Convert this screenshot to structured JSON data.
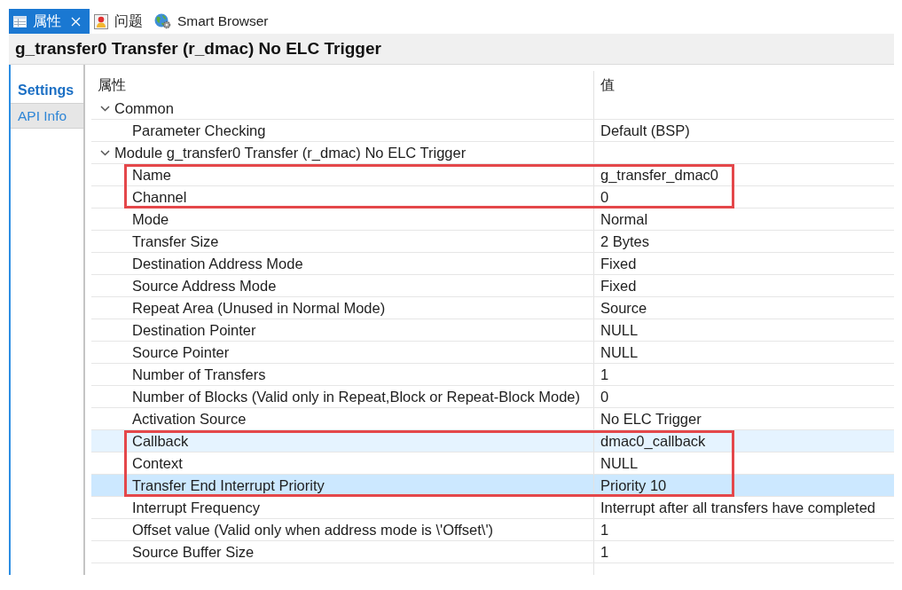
{
  "tabs": [
    {
      "label": "属性",
      "selected": true,
      "closable": true
    },
    {
      "label": "问题",
      "selected": false,
      "closable": false
    },
    {
      "label": "Smart Browser",
      "selected": false,
      "closable": false
    }
  ],
  "title": "g_transfer0 Transfer (r_dmac) No ELC Trigger",
  "side_tabs": [
    {
      "label": "Settings",
      "selected": true
    },
    {
      "label": "API Info",
      "selected": false
    }
  ],
  "properties": {
    "columns": [
      "属性",
      "值"
    ],
    "rows": [
      {
        "label": "Common",
        "expanded": true,
        "selected": false,
        "hovered": false,
        "children": [
          {
            "label": "Parameter Checking",
            "value": "Default (BSP)",
            "selected": false,
            "hovered": false,
            "marked": false
          }
        ]
      },
      {
        "label": "Module g_transfer0 Transfer (r_dmac) No ELC Trigger",
        "expanded": true,
        "selected": false,
        "hovered": false,
        "children": [
          {
            "label": "Name",
            "value": "g_transfer_dmac0",
            "selected": false,
            "hovered": false,
            "marked": true
          },
          {
            "label": "Channel",
            "value": "0",
            "selected": false,
            "hovered": false,
            "marked": true
          },
          {
            "label": "Mode",
            "value": "Normal",
            "selected": false,
            "hovered": false,
            "marked": false
          },
          {
            "label": "Transfer Size",
            "value": "2 Bytes",
            "selected": false,
            "hovered": false,
            "marked": false
          },
          {
            "label": "Destination Address Mode",
            "value": "Fixed",
            "selected": false,
            "hovered": false,
            "marked": false
          },
          {
            "label": "Source Address Mode",
            "value": "Fixed",
            "selected": false,
            "hovered": false,
            "marked": false
          },
          {
            "label": "Repeat Area (Unused in Normal Mode)",
            "value": "Source",
            "selected": false,
            "hovered": false,
            "marked": false
          },
          {
            "label": "Destination Pointer",
            "value": "NULL",
            "selected": false,
            "hovered": false,
            "marked": false
          },
          {
            "label": "Source Pointer",
            "value": "NULL",
            "selected": false,
            "hovered": false,
            "marked": false
          },
          {
            "label": "Number of Transfers",
            "value": "1",
            "selected": false,
            "hovered": false,
            "marked": false
          },
          {
            "label": "Number of Blocks (Valid only in Repeat,Block or Repeat-Block Mode)",
            "value": "0",
            "selected": false,
            "hovered": false,
            "marked": false
          },
          {
            "label": "Activation Source",
            "value": "No ELC Trigger",
            "selected": false,
            "hovered": false,
            "marked": false
          },
          {
            "label": "Callback",
            "value": "dmac0_callback",
            "selected": false,
            "hovered": true,
            "marked": true
          },
          {
            "label": "Context",
            "value": "NULL",
            "selected": false,
            "hovered": false,
            "marked": true
          },
          {
            "label": "Transfer End Interrupt Priority",
            "value": "Priority 10",
            "selected": true,
            "hovered": false,
            "marked": true
          },
          {
            "label": "Interrupt Frequency",
            "value": "Interrupt after all transfers have completed",
            "selected": false,
            "hovered": false,
            "marked": false
          },
          {
            "label": "Offset value (Valid only when address mode is \\'Offset\\')",
            "value": "1",
            "selected": false,
            "hovered": false,
            "marked": false
          },
          {
            "label": "Source Buffer Size",
            "value": "1",
            "selected": false,
            "hovered": false,
            "marked": false
          }
        ]
      }
    ]
  }
}
